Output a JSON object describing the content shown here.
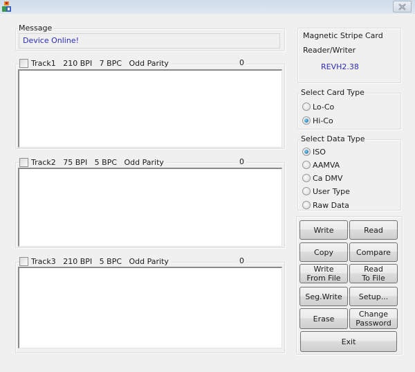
{
  "window": {
    "title": "",
    "app_icon": "app-icon",
    "close_icon": "close-x-icon"
  },
  "message": {
    "label": "Message",
    "value": "Device Online!",
    "value_color": "#2b2bb8"
  },
  "tracks": [
    {
      "label": "Track1   210 BPI   7 BPC   Odd Parity",
      "checked": false,
      "count": "0",
      "content": ""
    },
    {
      "label": "Track2   75 BPI   5 BPC   Odd Parity",
      "checked": false,
      "count": "0",
      "content": ""
    },
    {
      "label": "Track3   210 BPI   5 BPC   Odd Parity",
      "checked": false,
      "count": "0",
      "content": ""
    }
  ],
  "device_info": {
    "line1": "Magnetic Stripe Card",
    "line2": "Reader/Writer",
    "revision": "REVH2.38"
  },
  "card_type": {
    "label": "Select Card Type",
    "options": [
      {
        "label": "Lo-Co",
        "selected": false
      },
      {
        "label": "Hi-Co",
        "selected": true
      }
    ]
  },
  "data_type": {
    "label": "Select Data Type",
    "options": [
      {
        "label": "ISO",
        "selected": true
      },
      {
        "label": "AAMVA",
        "selected": false
      },
      {
        "label": "Ca DMV",
        "selected": false
      },
      {
        "label": "User Type",
        "selected": false
      },
      {
        "label": "Raw Data",
        "selected": false
      }
    ]
  },
  "buttons": {
    "write": "Write",
    "read": "Read",
    "copy": "Copy",
    "compare": "Compare",
    "write_from_file": "Write\nFrom File",
    "read_to_file": "Read\nTo File",
    "seg_write": "Seg.Write",
    "setup": "Setup...",
    "erase": "Erase",
    "change_password": "Change\nPassword",
    "exit": "Exit"
  }
}
